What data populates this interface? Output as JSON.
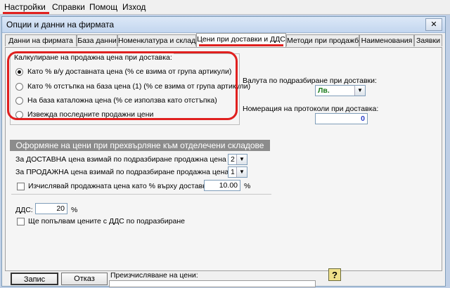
{
  "menu": [
    "Настройки",
    "Справки",
    "Помощ",
    "Изход"
  ],
  "window": {
    "title": "Опции и данни на фирмата",
    "close_glyph": "✕"
  },
  "tabs": [
    {
      "label": "Данни на фирмата",
      "active": false
    },
    {
      "label": "База данни",
      "active": false
    },
    {
      "label": "Номенклатура и склад",
      "active": false
    },
    {
      "label": "Цени при доставки и ДДС",
      "active": true
    },
    {
      "label": "Методи при продажби",
      "active": false
    },
    {
      "label": "Наименования",
      "active": false
    },
    {
      "label": "Заявки",
      "active": false
    }
  ],
  "calc_group": {
    "title": "Калкулиране на продажна цена при доставка:",
    "options": [
      {
        "label": "Като % в/у доставната цена (% се взима от група артикули)",
        "checked": true
      },
      {
        "label": "Като % отстъпка на база цена (1) (% се взима от група артикули)",
        "checked": false
      },
      {
        "label": "На база каталожна цена (% се използва като отстъпка)",
        "checked": false
      },
      {
        "label": "Извежда последните продажни цени",
        "checked": false
      }
    ]
  },
  "currency": {
    "label": "Валута по подразбиране при доставки:",
    "value": "Лв."
  },
  "protocol": {
    "label": "Номерация на протоколи при доставка:",
    "value": "0"
  },
  "transfer": {
    "header": "Оформяне на цени при прехвърляне към отделечени складове",
    "delivery_label": "За ДОСТАВНА цена взимай по подразбиране продажна цена №",
    "delivery_value": "2",
    "sale_label": "За ПРОДАЖНА цена взимай по подразбиране продажна цена №",
    "sale_value": "1",
    "calc_label": "Изчислявай продажната цена като % върху доставната",
    "calc_value": "10.00",
    "calc_unit": "%"
  },
  "vat": {
    "label": "ДДС:",
    "value": "20",
    "unit": "%",
    "checkbox_label": "Ще попълвам цените с ДДС по подразбиране"
  },
  "footer": {
    "save": "Запис",
    "cancel": "Отказ",
    "recalc_label": "Преизчисляване на цени:",
    "help": "?"
  },
  "colors": {
    "annotation": "#e0201f"
  }
}
